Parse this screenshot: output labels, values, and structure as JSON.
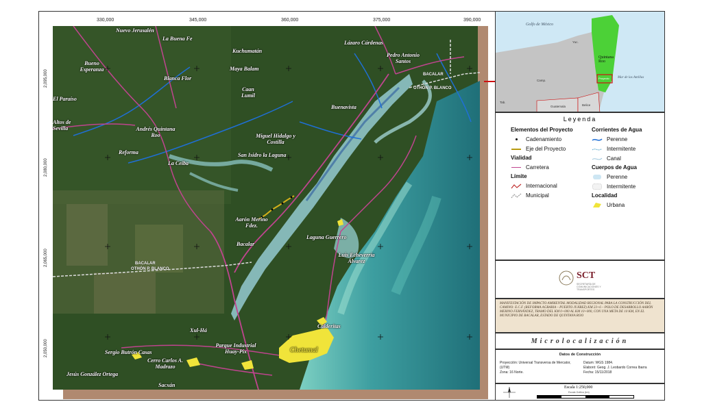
{
  "x_ticks": [
    "330,000",
    "345,000",
    "360,000",
    "375,000",
    "390,000"
  ],
  "y_ticks": [
    "2,095,000",
    "2,080,000",
    "2,065,000",
    "2,050,000"
  ],
  "places": {
    "nuevo_jerusalen": "Nuevo Jerusalén",
    "la_buena_fe": "La Buena Fe",
    "bueno_esperanza": "Bueno Esperanza",
    "kuchumatan": "Kuchumatán",
    "lazaro_cardenas": "Lázaro Cárdenas",
    "pedro_antonio_santos": "Pedro Antonio Santos",
    "mayabalam": "Maya Balam",
    "blanca_flor": "Blanca Flor",
    "caan_lumil": "Caan Lumil",
    "el_paraiso": "El Paraíso",
    "altos_sevilla": "Altos de Sevilla",
    "andres_q_roo": "Andrés Quintana Roo",
    "reforma": "Reforma",
    "la_ceiba": "La Ceiba",
    "miguel_hidalgo": "Miguel Hidalgo y Costilla",
    "san_isidro": "San Isidro la Laguna",
    "buenavista": "Buenavista",
    "aaron_merino": "Aarón Merino Fdez.",
    "bacalar": "Bacalar",
    "laguna_guerrero": "Laguna Guerrero",
    "luis_echeverria": "Luis Echeverría Álvarez",
    "xul_ha": "Xul-Há",
    "calderitas": "Calderitas",
    "chetumal": "Chetumal",
    "sergio_butron": "Sergio Butrón Casas",
    "cerro": "Cerro Carlos A. Madrazo",
    "parque_industrial": "Parque Industrial Huay-Pix",
    "jesus_gonzalez": "Jesús González Ortega",
    "subteniente": "Sacxán",
    "bacalar_border": "BACALAR",
    "othon_border": "OTHÓN P. BLANCO",
    "bacalar_border_ne": "BACALAR",
    "othon_border_ne": "OTHÓN P. BLANCO"
  },
  "inset": {
    "gulf": "Golfo de México",
    "state": "Quintana Roo",
    "sea": "Mar de las Antillas",
    "region_label": "Proyecto",
    "belize": "Belice",
    "guatemala": "Guatemala",
    "yucatan": "Yuc.",
    "campeche": "Camp.",
    "tabasco": "Tab."
  },
  "legend": {
    "title": "Leyenda",
    "project": {
      "header": "Elementos del Proyecto",
      "items": [
        "Cadenamiento",
        "Eje del Proyecto"
      ]
    },
    "roads": {
      "header": "Vialidad",
      "items": [
        "Carretera"
      ]
    },
    "limits": {
      "header": "Límite",
      "items": [
        "Internacional",
        "Municipal"
      ]
    },
    "streams": {
      "header": "Corrientes de Agua",
      "items": [
        "Perenne",
        "Intermitente",
        "Canal"
      ]
    },
    "water": {
      "header": "Cuerpos de Agua",
      "items": [
        "Perenne",
        "Intermitente"
      ]
    },
    "locality": {
      "header": "Localidad",
      "items": [
        "Urbana"
      ]
    }
  },
  "logo": {
    "name": "SCT",
    "sub": "SECRETARÍA DE COMUNICACIONES Y TRANSPORTES"
  },
  "title_block": "MANIFESTACIÓN DE IMPACTO AMBIENTAL MODALIDAD REGIONAL PARA LA CONSTRUCCIÓN DEL CAMINO: E.C.F. (REFORMA AGRARIA – PUERTO JUÁREZ) KM 23+6 – POLO DE DESARROLLO AARÓN MERINO FERNÁNDEZ, TRAMO DEL KM 0+000 AL KM 10+000, CON UNA META DE 10 KM, EN EL MUNICIPIO DE BACALAR, ESTADO DE QUINTANA ROO",
  "subtitle": "Microlocalización",
  "datos": {
    "title": "Datos de Construcción",
    "left": [
      "Proyección: Universal Transversa de Mercator,",
      "(UTM)",
      "Zona: 16 Norte."
    ],
    "right": [
      "Datum: WGS 1984.",
      "Elaboró: Geog. J. Leobardo Correa Ibarra",
      "Fecha: 15/11/2018"
    ]
  },
  "scale": {
    "label": "Escala 1:250,000",
    "bar_note": "Escala Gráfica (km)"
  },
  "colors": {
    "forest": "#2d4d22",
    "road": "#c0448f",
    "water_perenne": "#1f6fd6",
    "urban": "#f0e43a",
    "lagoon": "#8ec7c7",
    "sea_shallow": "#5cb8b0",
    "map_border": "#b08970",
    "inset_land": "#bfbfbf",
    "inset_qroo": "#4cd137"
  }
}
